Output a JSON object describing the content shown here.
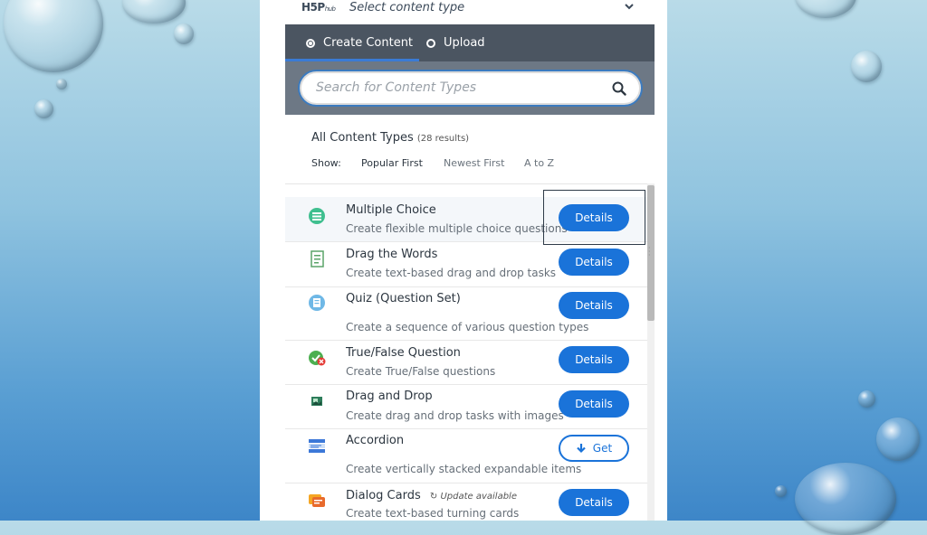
{
  "header": {
    "logo_main": "H5P",
    "logo_sub": "hub",
    "title": "Select content type"
  },
  "tabs": [
    {
      "label": "Create Content",
      "selected": true
    },
    {
      "label": "Upload",
      "selected": false
    }
  ],
  "search": {
    "placeholder": "Search for Content Types",
    "value": ""
  },
  "list_header": {
    "title": "All Content Types",
    "count": "(28 results)",
    "show_label": "Show:",
    "sort_options": [
      "Popular First",
      "Newest First",
      "A to Z"
    ],
    "active_sort": "Popular First"
  },
  "items": [
    {
      "title": "Multiple Choice",
      "description": "Create flexible multiple choice questions",
      "button": "Details",
      "icon": "multiple-choice-icon",
      "badge": ""
    },
    {
      "title": "Drag the Words",
      "description": "Create text-based drag and drop tasks",
      "button": "Details",
      "icon": "drag-words-icon",
      "badge": ""
    },
    {
      "title": "Quiz (Question Set)",
      "description": "Create a sequence of various question types",
      "button": "Details",
      "icon": "quiz-icon",
      "badge": ""
    },
    {
      "title": "True/False Question",
      "description": "Create True/False questions",
      "button": "Details",
      "icon": "true-false-icon",
      "badge": ""
    },
    {
      "title": "Drag and Drop",
      "description": "Create drag and drop tasks with images",
      "button": "Details",
      "icon": "drag-drop-icon",
      "badge": ""
    },
    {
      "title": "Accordion",
      "description": "Create vertically stacked expandable items",
      "button": "Get",
      "icon": "accordion-icon",
      "badge": ""
    },
    {
      "title": "Dialog Cards",
      "description": "Create text-based turning cards",
      "button": "Details",
      "icon": "dialog-cards-icon",
      "badge": "Update available"
    }
  ],
  "colors": {
    "accent": "#1a73d9",
    "tab_bar": "#4b5561",
    "search_band": "#6d7885"
  }
}
